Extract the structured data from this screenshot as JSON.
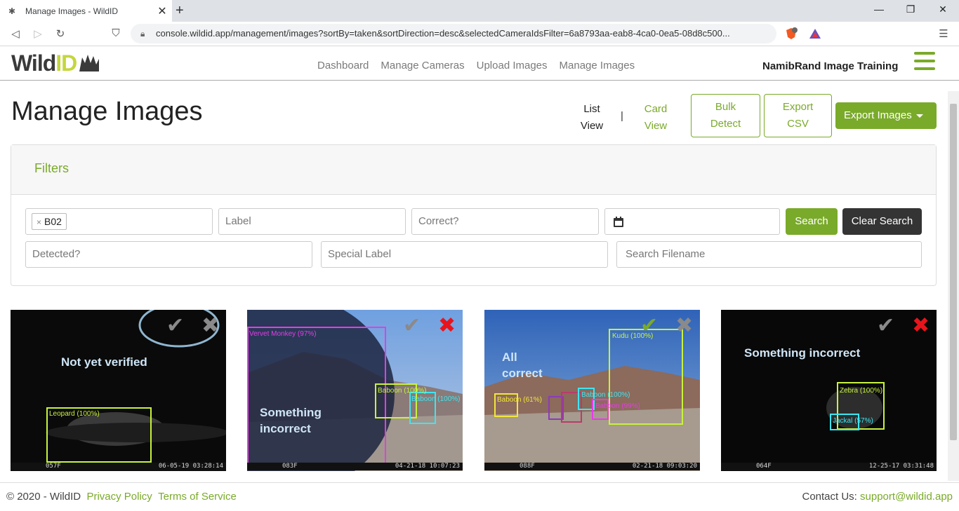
{
  "browser": {
    "tab_title": "Manage Images - WildID",
    "url": "console.wildid.app/management/images?sortBy=taken&sortDirection=desc&selectedCameraIdsFilter=6a8793aa-eab8-4ca0-0ea5-08d8c500..."
  },
  "header": {
    "logo_text_a": "Wild",
    "logo_text_b": "ID",
    "nav": [
      "Dashboard",
      "Manage Cameras",
      "Upload Images",
      "Manage Images"
    ],
    "org_name": "NamibRand Image Training"
  },
  "page": {
    "title": "Manage Images",
    "list_view": [
      "List",
      "View"
    ],
    "card_view": [
      "Card",
      "View"
    ],
    "separator": "|",
    "bulk_detect": [
      "Bulk",
      "Detect"
    ],
    "export_csv": [
      "Export",
      "CSV"
    ],
    "export_images": "Export Images"
  },
  "filters": {
    "heading": "Filters",
    "camera_chip": "B02",
    "camera_chip_remove": "×",
    "label_placeholder": "Label",
    "correct_placeholder": "Correct?",
    "date_value": "",
    "search_label": "Search",
    "clear_label": "Clear Search",
    "detected_placeholder": "Detected?",
    "special_label_placeholder": "Special Label",
    "filename_placeholder": "Search Filename"
  },
  "cards": [
    {
      "note": [
        "Not yet verified"
      ],
      "camera": "057F",
      "datetime": "06-05-19   03:28:14",
      "labels": [
        {
          "text": "Leopard (100%)",
          "color": "#c8f23c"
        }
      ],
      "status": "unverified"
    },
    {
      "note": [
        "Something",
        "incorrect"
      ],
      "camera": "083F",
      "datetime": "04-21-18   10:07:23",
      "labels": [
        {
          "text": "Vervet Monkey (97%)",
          "color": "#e63ce6"
        },
        {
          "text": "Baboon (100%)",
          "color": "#c8f23c"
        },
        {
          "text": "Baboon (100%)",
          "color": "#3ce6f2"
        }
      ],
      "status": "incorrect"
    },
    {
      "note": [
        "All",
        "correct"
      ],
      "camera": "088F",
      "datetime": "02-21-18   09:03:20",
      "labels": [
        {
          "text": "Kudu (100%)",
          "color": "#c8f23c"
        },
        {
          "text": "Baboon (61%)",
          "color": "#f2e63c"
        },
        {
          "text": "Baboon (100%)",
          "color": "#3ce6f2"
        },
        {
          "text": "Baboon (99%)",
          "color": "#e63ce6"
        }
      ],
      "status": "correct"
    },
    {
      "note": [
        "Something incorrect"
      ],
      "camera": "064F",
      "datetime": "12-25-17   03:31:48",
      "labels": [
        {
          "text": "Zebra (100%)",
          "color": "#c8f23c"
        },
        {
          "text": "Jackal (57%)",
          "color": "#3ce6f2"
        }
      ],
      "status": "incorrect"
    }
  ],
  "footer": {
    "copyright": "© 2020 - WildID",
    "privacy": "Privacy Policy",
    "terms": "Terms of Service",
    "contact_label": "Contact Us:",
    "contact_email": "support@wildid.app"
  },
  "colors": {
    "accent": "#7aaa2a",
    "reject_active": "#e8141c",
    "approve_active": "#7aaa2a"
  }
}
